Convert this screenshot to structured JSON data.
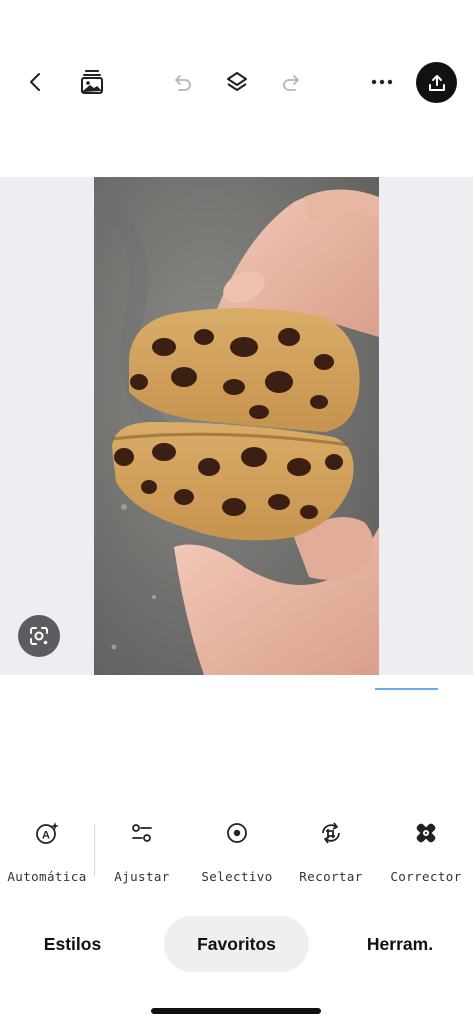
{
  "toolbar": {
    "icons": [
      "chevron-left-icon",
      "gallery-icon",
      "undo-icon",
      "layers-icon",
      "redo-icon",
      "more-icon",
      "share-icon"
    ]
  },
  "tools": [
    {
      "label": "Automática",
      "icon": "auto-enhance-icon"
    },
    {
      "label": "Ajustar",
      "icon": "sliders-icon"
    },
    {
      "label": "Selectivo",
      "icon": "target-icon"
    },
    {
      "label": "Recortar",
      "icon": "crop-rotate-icon"
    },
    {
      "label": "Corrector",
      "icon": "bandage-icon"
    }
  ],
  "tabs": [
    {
      "label": "Estilos",
      "selected": false
    },
    {
      "label": "Favoritos",
      "selected": true
    },
    {
      "label": "Herram.",
      "selected": false
    }
  ],
  "colors": {
    "canvas_bg": "#eceef2",
    "accent_line": "#6aa7f0",
    "share_button": "#111111",
    "selected_tab_bg": "#efefef"
  }
}
